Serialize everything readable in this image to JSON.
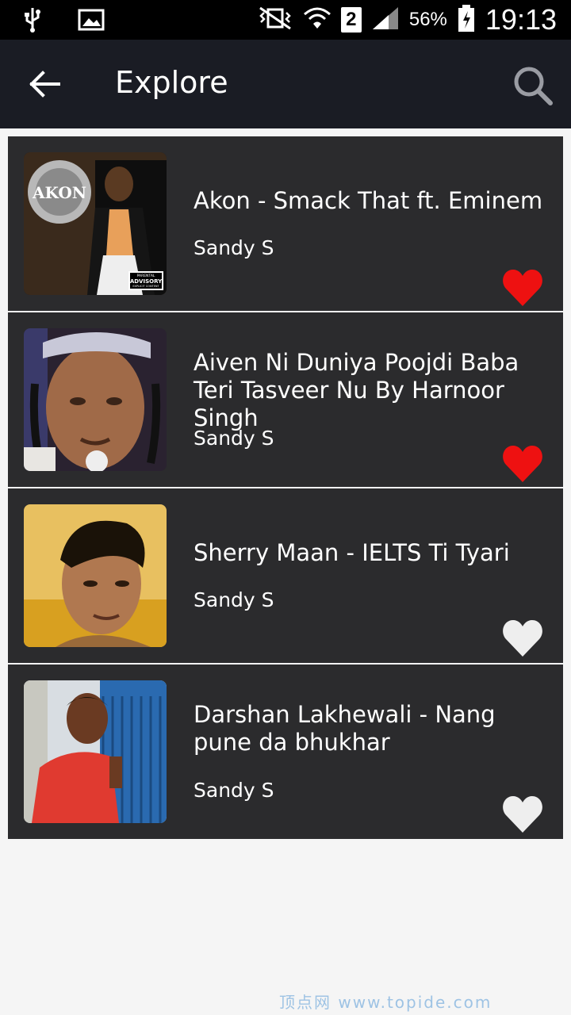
{
  "status_bar": {
    "battery_percent": "56%",
    "time": "19:13",
    "sim_slot": "2",
    "icons": [
      "usb-icon",
      "image-notification-icon",
      "vibrate-icon",
      "wifi-icon",
      "signal-icon",
      "battery-icon"
    ]
  },
  "app_bar": {
    "title": "Explore",
    "back_icon": "arrow-left-icon",
    "search_icon": "search-icon"
  },
  "songs": [
    {
      "title": "Akon - Smack That ft. Eminem",
      "artist": "Sandy S",
      "favorite": true
    },
    {
      "title": "Aiven Ni Duniya Poojdi Baba Teri Tasveer Nu By Harnoor Singh",
      "artist": "Sandy S",
      "favorite": true
    },
    {
      "title": "Sherry Maan - IELTS Ti Tyari",
      "artist": "Sandy S",
      "favorite": false
    },
    {
      "title": "Darshan Lakhewali - Nang pune da bhukhar",
      "artist": "Sandy S",
      "favorite": false
    }
  ],
  "album_art_text": {
    "akon_logo": "AKON",
    "parental_advisory_top": "PARENTAL",
    "parental_advisory_main": "ADVISORY",
    "parental_advisory_bottom": "EXPLICIT CONTENT"
  },
  "colors": {
    "app_bar_bg": "#1a1c24",
    "row_bg": "#2b2b2d",
    "heart_favorite": "#ee1111",
    "heart_default": "#eeeeee"
  },
  "watermark": "顶点网 www.topide.com"
}
